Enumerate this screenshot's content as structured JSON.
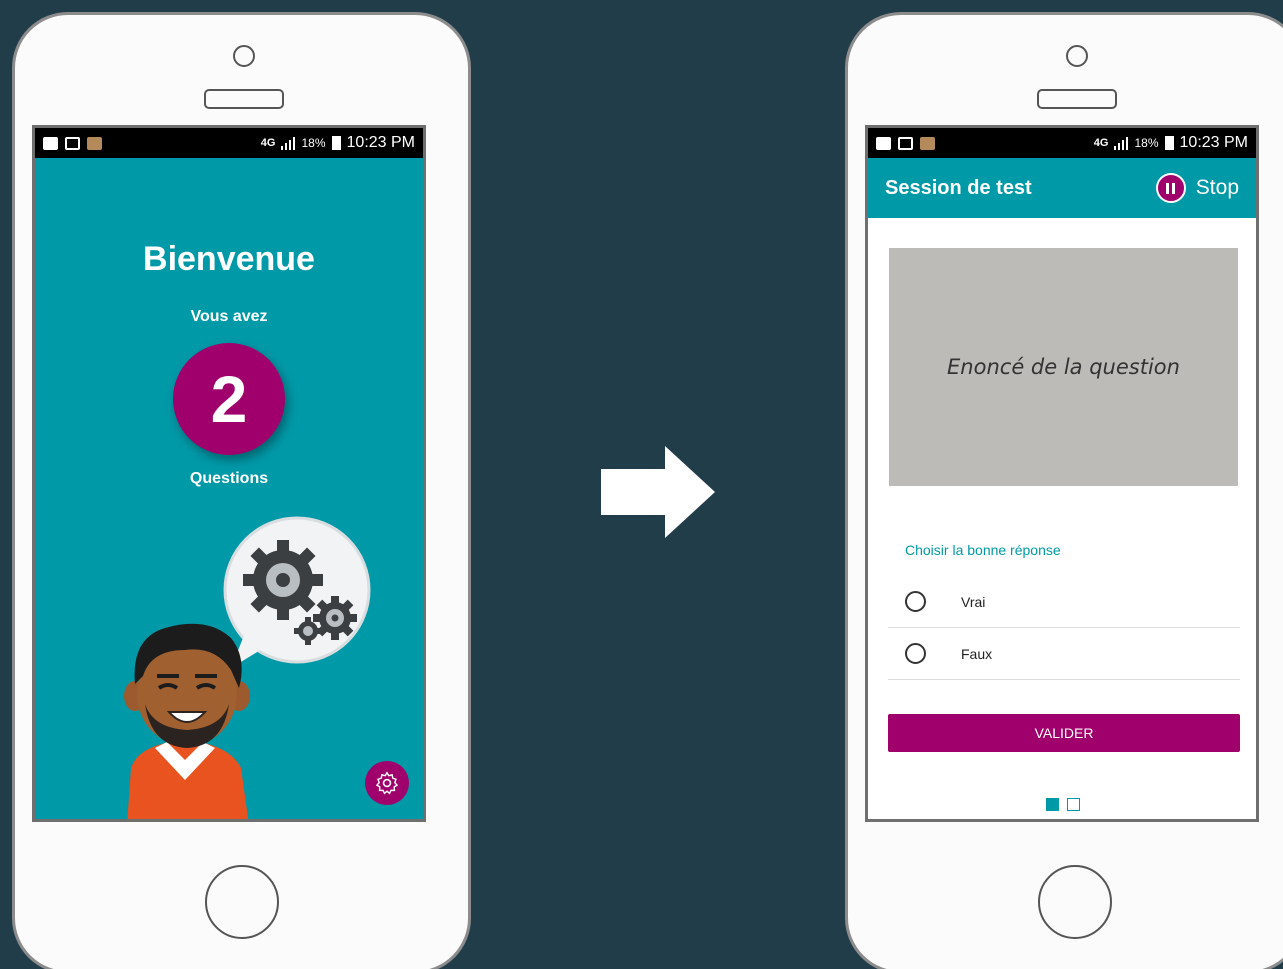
{
  "status_bar": {
    "network": "4G",
    "battery": "18%",
    "time": "10:23 PM"
  },
  "welcome_screen": {
    "title": "Bienvenue",
    "subtitle": "Vous avez",
    "question_count": "2",
    "count_label": "Questions",
    "settings_icon": "gear-icon"
  },
  "question_screen": {
    "app_bar_title": "Session de test",
    "stop_label": "Stop",
    "stop_icon": "pause-icon",
    "question_placeholder": "Enoncé de la question",
    "prompt": "Choisir la bonne réponse",
    "options": [
      {
        "label": "Vrai"
      },
      {
        "label": "Faux"
      }
    ],
    "submit_label": "VALIDER"
  },
  "colors": {
    "background": "#223d4a",
    "teal": "#0099a8",
    "magenta": "#a0006b"
  }
}
